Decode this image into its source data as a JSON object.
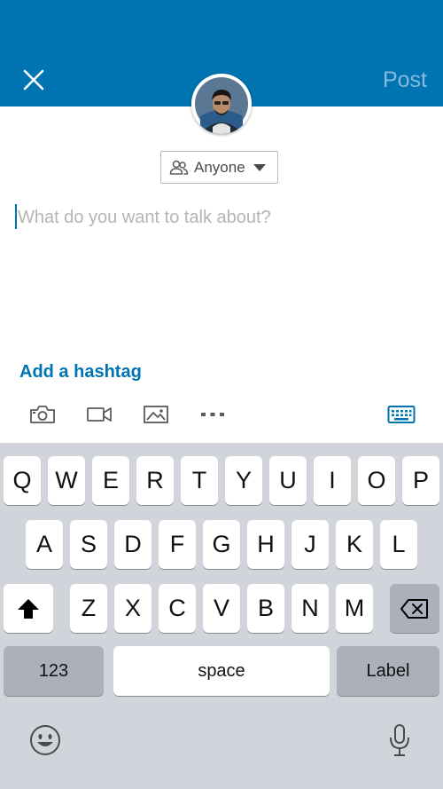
{
  "header": {
    "close_icon": "close-icon",
    "post_label": "Post",
    "background_color": "#0073b1",
    "post_color": "#86b9dd"
  },
  "avatar": {
    "icon": "profile-photo"
  },
  "audience": {
    "label": "Anyone",
    "icon": "people-icon",
    "caret_icon": "caret-down-icon"
  },
  "composer": {
    "placeholder": "What do you want to talk about?",
    "value": ""
  },
  "hashtag_link": "Add a hashtag",
  "toolbar": {
    "items": [
      "camera-icon",
      "video-icon",
      "image-icon",
      "more-icon",
      "keyboard-icon"
    ]
  },
  "keyboard": {
    "row1": [
      "Q",
      "W",
      "E",
      "R",
      "T",
      "Y",
      "U",
      "I",
      "O",
      "P"
    ],
    "row2": [
      "A",
      "S",
      "D",
      "F",
      "G",
      "H",
      "J",
      "K",
      "L"
    ],
    "row3": [
      "Z",
      "X",
      "C",
      "V",
      "B",
      "N",
      "M"
    ],
    "numbers_label": "123",
    "space_label": "space",
    "return_label": "Label",
    "shift_icon": "shift-icon",
    "delete_icon": "backspace-icon",
    "emoji_icon": "emoji-icon",
    "mic_icon": "microphone-icon"
  }
}
